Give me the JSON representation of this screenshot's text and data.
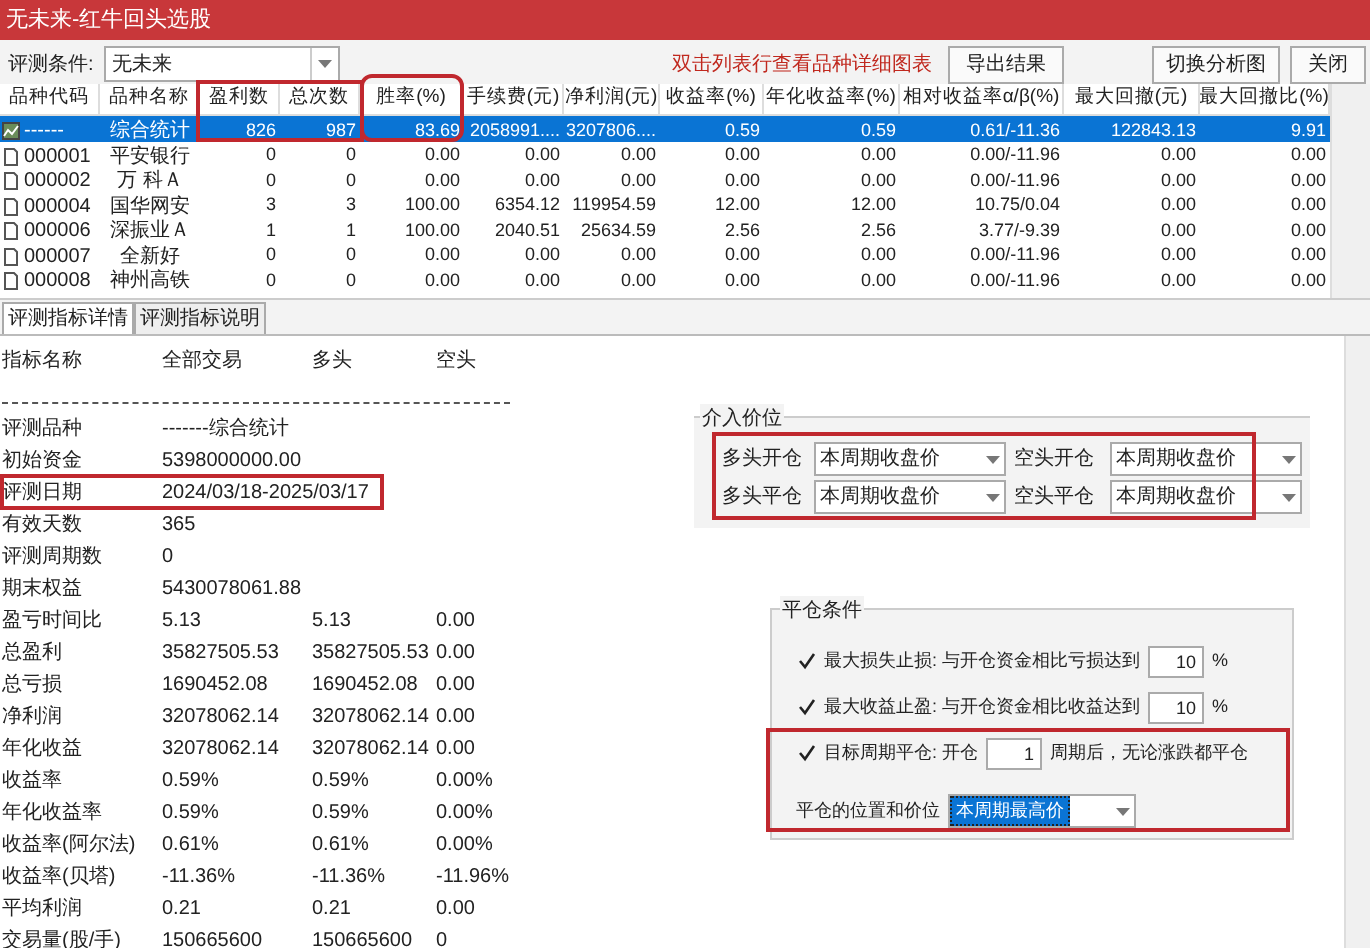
{
  "window": {
    "title": "无未来-红牛回头选股"
  },
  "toolbar": {
    "condition_label": "评测条件:",
    "condition_value": "无未来",
    "hint": "双击列表行查看品种详细图表",
    "buttons": [
      "导出结果",
      "切换分析图",
      "关闭"
    ]
  },
  "table": {
    "columns": [
      "品种代码",
      "品种名称",
      "盈利数",
      "总次数",
      "胜率(%)",
      "手续费(元)",
      "净利润(元)",
      "收益率(%)",
      "年化收益率(%)",
      "相对收益率α/β(%)",
      "最大回撤(元)",
      "最大回撤比(%)"
    ],
    "rows": [
      {
        "kind": "summary",
        "selected": true,
        "cells": [
          "------",
          "综合统计",
          "826",
          "987",
          "83.69",
          "2058991....",
          "3207806....",
          "0.59",
          "0.59",
          "0.61/-11.36",
          "122843.13",
          "9.91"
        ]
      },
      {
        "kind": "stock",
        "selected": false,
        "cells": [
          "000001",
          "平安银行",
          "0",
          "0",
          "0.00",
          "0.00",
          "0.00",
          "0.00",
          "0.00",
          "0.00/-11.96",
          "0.00",
          "0.00"
        ]
      },
      {
        "kind": "stock",
        "selected": false,
        "cells": [
          "000002",
          "万 科Ａ",
          "0",
          "0",
          "0.00",
          "0.00",
          "0.00",
          "0.00",
          "0.00",
          "0.00/-11.96",
          "0.00",
          "0.00"
        ]
      },
      {
        "kind": "stock",
        "selected": false,
        "cells": [
          "000004",
          "国华网安",
          "3",
          "3",
          "100.00",
          "6354.12",
          "119954.59",
          "12.00",
          "12.00",
          "10.75/0.04",
          "0.00",
          "0.00"
        ]
      },
      {
        "kind": "stock",
        "selected": false,
        "cells": [
          "000006",
          "深振业Ａ",
          "1",
          "1",
          "100.00",
          "2040.51",
          "25634.59",
          "2.56",
          "2.56",
          "3.77/-9.39",
          "0.00",
          "0.00"
        ]
      },
      {
        "kind": "stock",
        "selected": false,
        "cells": [
          "000007",
          "全新好",
          "0",
          "0",
          "0.00",
          "0.00",
          "0.00",
          "0.00",
          "0.00",
          "0.00/-11.96",
          "0.00",
          "0.00"
        ]
      },
      {
        "kind": "stock",
        "selected": false,
        "cells": [
          "000008",
          "神州高铁",
          "0",
          "0",
          "0.00",
          "0.00",
          "0.00",
          "0.00",
          "0.00",
          "0.00/-11.96",
          "0.00",
          "0.00"
        ]
      }
    ]
  },
  "tabs": [
    {
      "label": "评测指标详情",
      "selected": true
    },
    {
      "label": "评测指标说明",
      "selected": false
    }
  ],
  "details": {
    "columns": [
      "指标名称",
      "全部交易",
      "多头",
      "空头"
    ],
    "rows": [
      {
        "label": "评测品种",
        "values": [
          "-------综合统计"
        ]
      },
      {
        "label": "初始资金",
        "values": [
          "5398000000.00"
        ]
      },
      {
        "label": "评测日期",
        "values": [
          "2024/03/18-2025/03/17"
        ]
      },
      {
        "label": "有效天数",
        "values": [
          "365"
        ]
      },
      {
        "label": "评测周期数",
        "values": [
          "0"
        ]
      },
      {
        "label": "期末权益",
        "values": [
          "5430078061.88"
        ]
      },
      {
        "label": "盈亏时间比",
        "values": [
          "5.13",
          "5.13",
          "0.00"
        ]
      },
      {
        "label": "总盈利",
        "values": [
          "35827505.53",
          "35827505.53",
          "0.00"
        ]
      },
      {
        "label": "总亏损",
        "values": [
          "1690452.08",
          "1690452.08",
          "0.00"
        ]
      },
      {
        "label": "净利润",
        "values": [
          "32078062.14",
          "32078062.14",
          "0.00"
        ]
      },
      {
        "label": "年化收益",
        "values": [
          "32078062.14",
          "32078062.14",
          "0.00"
        ]
      },
      {
        "label": "收益率",
        "values": [
          "0.59%",
          "0.59%",
          "0.00%"
        ]
      },
      {
        "label": "年化收益率",
        "values": [
          "0.59%",
          "0.59%",
          "0.00%"
        ]
      },
      {
        "label": "收益率(阿尔法)",
        "values": [
          "0.61%",
          "0.61%",
          "0.00%"
        ]
      },
      {
        "label": "收益率(贝塔)",
        "values": [
          "-11.36%",
          "-11.36%",
          "-11.96%"
        ]
      },
      {
        "label": "平均利润",
        "values": [
          "0.21",
          "0.21",
          "0.00"
        ]
      },
      {
        "label": "交易量(股/手)",
        "values": [
          "150665600",
          "150665600",
          "0"
        ]
      }
    ]
  },
  "entry_price": {
    "title": "介入价位",
    "fields": [
      {
        "label": "多头开仓",
        "value": "本周期收盘价"
      },
      {
        "label": "空头开仓",
        "value": "本周期收盘价"
      },
      {
        "label": "多头平仓",
        "value": "本周期收盘价"
      },
      {
        "label": "空头平仓",
        "value": "本周期收盘价"
      }
    ]
  },
  "exit_conditions": {
    "title": "平仓条件",
    "rules": [
      {
        "kind": "input",
        "checked": true,
        "label": "最大损失止损: 与开仓资金相比亏损达到",
        "value": "10",
        "unit": "%"
      },
      {
        "kind": "input",
        "checked": true,
        "label": "最大收益止盈: 与开仓资金相比收益达到",
        "value": "10",
        "unit": "%"
      },
      {
        "kind": "input",
        "checked": true,
        "label": "目标周期平仓: 开仓",
        "value": "1",
        "unit": "周期后，无论涨跌都平仓"
      },
      {
        "kind": "select",
        "label": "平仓的位置和价位",
        "value": "本周期最高价"
      }
    ]
  }
}
